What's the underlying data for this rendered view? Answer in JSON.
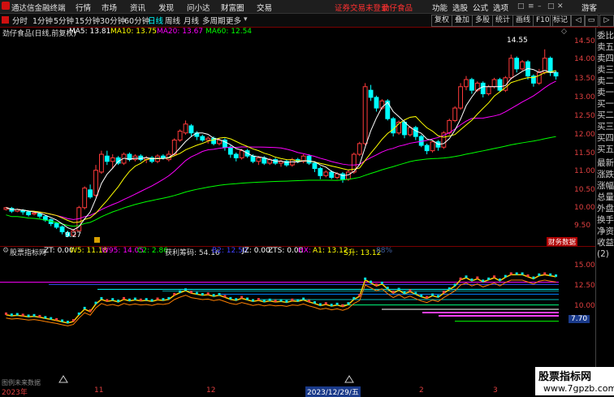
{
  "app": {
    "title": "通达信金融终端",
    "menu": [
      "行情",
      "市场",
      "资讯",
      "发现",
      "问小达",
      "财富圈",
      "交易"
    ],
    "warning": "证券交易未登录",
    "stock_link": "劲仔食品",
    "right_menu": [
      "功能",
      "选股",
      "公式",
      "选项"
    ],
    "user": "游客"
  },
  "toolbar": {
    "periods": [
      "分时",
      "1分钟",
      "5分钟",
      "15分钟",
      "30分钟",
      "60分钟",
      "日线",
      "周线",
      "月线",
      "多周期",
      "更多"
    ],
    "active_period": "日线",
    "buttons": [
      "复权",
      "叠加",
      "多股",
      "统计",
      "画线",
      "F10",
      "标记"
    ]
  },
  "indicator_bar": {
    "name": "劲仔食品(日线,前复权)",
    "ma5": "MA5: 13.81",
    "ma10": "MA10: 13.75",
    "ma20": "MA20: 13.67",
    "ma60": "MA60: 12.54",
    "colors": {
      "ma5": "#ffffff",
      "ma10": "#ffff00",
      "ma20": "#ff00ff",
      "ma60": "#00ff00"
    }
  },
  "lower_bar": {
    "name": "股票指标网",
    "zt": "ZT: 0.00",
    "w5": "W5: 11.18",
    "w95": "W95: 14.05",
    "c2": "C2: 2.86",
    "hl": "获利筹码: 54.16",
    "b2": "B2: 12.50",
    "jz": "JZ: 0.00",
    "zts": "ZTS: 0.00",
    "hx": "HX: -",
    "a1": "A1: 13.12",
    "s": "S升: 13.12",
    "tail": "88%"
  },
  "right_panel": [
    "委比",
    "卖五",
    "卖四",
    "卖三",
    "卖二",
    "卖一",
    "买一",
    "买二",
    "买三",
    "买四",
    "买五",
    "最新",
    "涨跌",
    "涨幅",
    "总量",
    "外盘",
    "换手",
    "净资",
    "收益"
  ],
  "right_panel_bottom": "(2)",
  "price_axis": [
    "14.50",
    "14.00",
    "13.50",
    "13.00",
    "12.50",
    "12.00",
    "11.50",
    "11.00",
    "10.50",
    "10.00",
    "9.50"
  ],
  "lower_axis": [
    "15.00",
    "12.50",
    "10.00",
    "7.70"
  ],
  "annotations": {
    "high": "14.55",
    "low": "9.27",
    "tag": "财务数据"
  },
  "lower_note": "图例未来数据",
  "date_axis": {
    "year": "2023年",
    "m11": "11",
    "m12": "12",
    "cursor": "2023/12/29/五",
    "m2": "2",
    "m3": "3"
  },
  "watermark": {
    "line1": "股票指标网",
    "line2": "www.7gpzb.com"
  },
  "chart_data": {
    "type": "candlestick",
    "ylim": [
      9.25,
      14.75
    ],
    "up_color": "#ff3b3b",
    "down_color": "#00ffff",
    "candles": [
      [
        10.05,
        10.1,
        10.02,
        10.12
      ],
      [
        10.08,
        10.0,
        9.95,
        10.12
      ],
      [
        10.0,
        10.05,
        9.97,
        10.08
      ],
      [
        10.03,
        9.98,
        9.9,
        10.06
      ],
      [
        9.98,
        9.9,
        9.85,
        10.02
      ],
      [
        9.92,
        9.95,
        9.88,
        10.0
      ],
      [
        9.93,
        9.86,
        9.8,
        9.97
      ],
      [
        9.85,
        9.75,
        9.7,
        9.9
      ],
      [
        9.76,
        9.65,
        9.58,
        9.8
      ],
      [
        9.66,
        9.55,
        9.5,
        9.7
      ],
      [
        9.56,
        9.42,
        9.35,
        9.6
      ],
      [
        9.4,
        9.3,
        9.27,
        9.45
      ],
      [
        9.32,
        9.45,
        9.3,
        9.5
      ],
      [
        9.45,
        10.1,
        9.45,
        10.15
      ],
      [
        10.1,
        10.65,
        10.05,
        10.7
      ],
      [
        10.6,
        10.4,
        10.35,
        10.75
      ],
      [
        10.45,
        11.15,
        10.4,
        11.3
      ],
      [
        11.1,
        11.6,
        11.05,
        11.7
      ],
      [
        11.55,
        11.4,
        11.3,
        11.7
      ],
      [
        11.4,
        11.5,
        11.2,
        11.6
      ],
      [
        11.5,
        11.35,
        11.3,
        11.55
      ],
      [
        11.35,
        11.6,
        11.3,
        11.65
      ],
      [
        11.6,
        11.45,
        11.4,
        11.65
      ],
      [
        11.45,
        11.55,
        11.4,
        11.6
      ],
      [
        11.55,
        11.45,
        11.4,
        11.6
      ],
      [
        11.45,
        11.5,
        11.35,
        11.55
      ],
      [
        11.5,
        11.4,
        11.35,
        11.55
      ],
      [
        11.4,
        11.55,
        11.35,
        11.6
      ],
      [
        11.55,
        11.5,
        11.45,
        11.6
      ],
      [
        11.45,
        11.6,
        11.4,
        11.7
      ],
      [
        11.6,
        12.0,
        11.55,
        12.05
      ],
      [
        12.0,
        12.25,
        11.95,
        12.3
      ],
      [
        12.2,
        12.45,
        12.15,
        12.55
      ],
      [
        12.4,
        12.2,
        12.1,
        12.45
      ],
      [
        12.2,
        12.1,
        12.0,
        12.25
      ],
      [
        12.1,
        12.0,
        11.95,
        12.15
      ],
      [
        12.0,
        12.05,
        11.9,
        12.1
      ],
      [
        12.05,
        11.9,
        11.85,
        12.1
      ],
      [
        11.9,
        12.0,
        11.85,
        12.05
      ],
      [
        12.0,
        11.8,
        11.7,
        12.05
      ],
      [
        11.8,
        11.6,
        11.5,
        11.85
      ],
      [
        11.6,
        11.5,
        11.4,
        11.65
      ],
      [
        11.5,
        11.7,
        11.45,
        11.75
      ],
      [
        11.7,
        11.55,
        11.5,
        11.75
      ],
      [
        11.55,
        11.4,
        11.35,
        11.6
      ],
      [
        11.4,
        11.5,
        11.3,
        11.55
      ],
      [
        11.5,
        11.35,
        11.3,
        11.55
      ],
      [
        11.35,
        11.45,
        11.3,
        11.5
      ],
      [
        11.45,
        11.35,
        11.3,
        11.5
      ],
      [
        11.35,
        11.4,
        11.25,
        11.45
      ],
      [
        11.4,
        11.3,
        11.25,
        11.45
      ],
      [
        11.3,
        11.45,
        11.25,
        11.5
      ],
      [
        11.45,
        11.4,
        11.35,
        11.5
      ],
      [
        11.4,
        11.55,
        11.35,
        11.6
      ],
      [
        11.55,
        11.35,
        11.3,
        11.6
      ],
      [
        11.35,
        11.2,
        11.1,
        11.4
      ],
      [
        11.2,
        11.0,
        10.9,
        11.25
      ],
      [
        11.0,
        11.1,
        10.95,
        11.15
      ],
      [
        11.1,
        10.95,
        10.9,
        11.15
      ],
      [
        10.95,
        11.05,
        10.9,
        11.1
      ],
      [
        11.05,
        10.9,
        10.8,
        11.1
      ],
      [
        10.9,
        11.1,
        10.85,
        11.15
      ],
      [
        11.1,
        11.6,
        11.05,
        11.65
      ],
      [
        11.6,
        11.9,
        11.55,
        11.95
      ],
      [
        11.9,
        13.5,
        11.85,
        13.6
      ],
      [
        13.4,
        13.2,
        13.1,
        13.55
      ],
      [
        13.2,
        12.9,
        12.8,
        13.25
      ],
      [
        12.9,
        13.1,
        12.85,
        13.15
      ],
      [
        13.1,
        12.6,
        12.55,
        13.15
      ],
      [
        12.6,
        12.2,
        12.1,
        12.65
      ],
      [
        12.2,
        12.5,
        12.15,
        12.55
      ],
      [
        12.5,
        12.15,
        12.05,
        12.55
      ],
      [
        12.15,
        12.35,
        12.1,
        12.4
      ],
      [
        12.35,
        12.1,
        12.0,
        12.4
      ],
      [
        12.1,
        11.85,
        11.8,
        12.15
      ],
      [
        11.85,
        11.7,
        11.6,
        11.9
      ],
      [
        11.7,
        11.95,
        11.65,
        12.0
      ],
      [
        11.95,
        11.8,
        11.7,
        12.0
      ],
      [
        11.8,
        12.2,
        11.75,
        12.25
      ],
      [
        12.2,
        12.55,
        12.15,
        12.6
      ],
      [
        12.55,
        12.9,
        12.5,
        12.95
      ],
      [
        12.9,
        13.5,
        12.85,
        13.6
      ],
      [
        13.5,
        13.7,
        13.4,
        13.8
      ],
      [
        13.7,
        13.4,
        13.3,
        13.75
      ],
      [
        13.4,
        13.6,
        13.35,
        13.65
      ],
      [
        13.6,
        13.3,
        13.2,
        13.65
      ],
      [
        13.3,
        13.5,
        13.25,
        13.55
      ],
      [
        13.5,
        13.7,
        13.45,
        13.75
      ],
      [
        13.7,
        13.4,
        13.35,
        13.75
      ],
      [
        13.4,
        13.75,
        13.35,
        13.8
      ],
      [
        13.75,
        14.3,
        13.7,
        14.4
      ],
      [
        14.3,
        14.0,
        13.9,
        14.35
      ],
      [
        14.0,
        14.2,
        13.95,
        14.25
      ],
      [
        14.2,
        13.8,
        13.7,
        14.25
      ],
      [
        13.8,
        13.6,
        13.5,
        13.85
      ],
      [
        13.6,
        13.9,
        13.55,
        14.0
      ],
      [
        13.9,
        14.3,
        13.85,
        14.55
      ],
      [
        14.3,
        13.9,
        13.8,
        14.35
      ],
      [
        13.9,
        13.8,
        13.7,
        13.95
      ]
    ]
  }
}
